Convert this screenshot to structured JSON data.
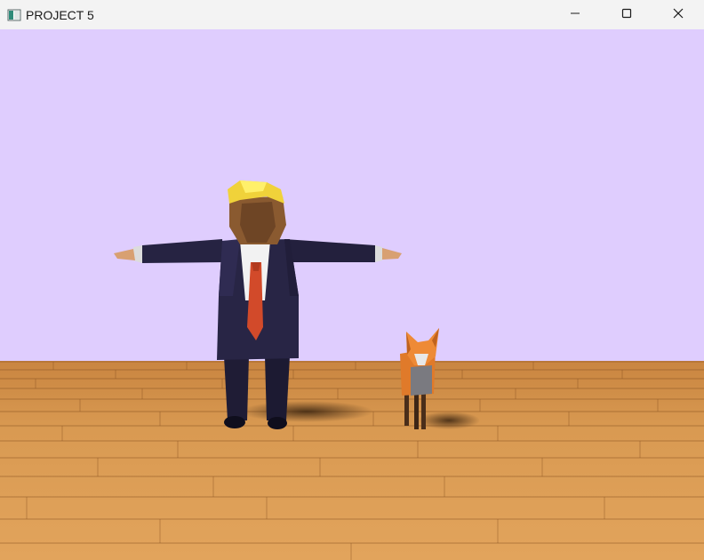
{
  "window": {
    "title": "PROJECT 5",
    "app_icon": "console-window-icon",
    "controls": {
      "minimize_icon": "minimize-icon",
      "maximize_icon": "maximize-icon",
      "close_icon": "close-icon"
    }
  },
  "scene": {
    "background_color": "#dfcdfe",
    "floor_color": "#d99a52",
    "objects": [
      "humanoid-character-model",
      "fox-model"
    ]
  }
}
